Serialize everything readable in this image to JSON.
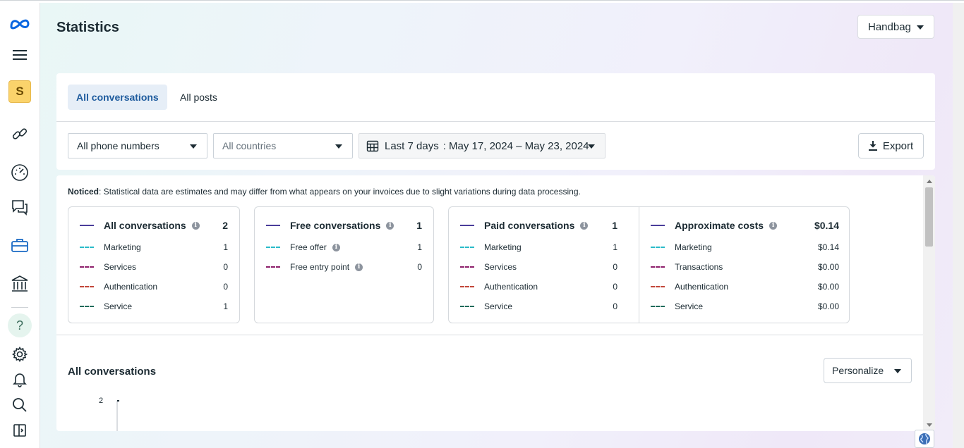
{
  "page": {
    "title": "Statistics"
  },
  "sidebar": {
    "items": [
      {
        "name": "meta-logo-icon"
      },
      {
        "name": "menu-icon"
      },
      {
        "name": "account-avatar",
        "label": "S"
      },
      {
        "name": "link-icon"
      },
      {
        "name": "dashboard-gauge-icon"
      },
      {
        "name": "chat-bubbles-icon"
      },
      {
        "name": "briefcase-icon"
      },
      {
        "name": "bank-icon"
      },
      {
        "name": "help-icon",
        "label": "?"
      },
      {
        "name": "gear-icon"
      },
      {
        "name": "bell-icon"
      },
      {
        "name": "search-icon"
      },
      {
        "name": "sidebar-panel-icon"
      }
    ]
  },
  "header": {
    "account_selector": "Handbag"
  },
  "tabs": [
    {
      "label": "All conversations",
      "active": true
    },
    {
      "label": "All posts",
      "active": false
    }
  ],
  "filters": {
    "phone": "All phone numbers",
    "country": "All countries",
    "date_range_label": "Last 7 days",
    "date_range": ": May 17, 2024 – May 23, 2024",
    "export_label": "Export"
  },
  "notice": {
    "label": "Noticed",
    "text": ": Statistical data are estimates and may differ from what appears on your invoices due to slight variations during data processing."
  },
  "stats": {
    "all_conversations": {
      "title": "All conversations",
      "total": "2",
      "rows": [
        {
          "label": "Marketing",
          "value": "1",
          "color": "#2bbbc9"
        },
        {
          "label": "Services",
          "value": "0",
          "color": "#8e1f6b"
        },
        {
          "label": "Authentication",
          "value": "0",
          "color": "#c2473a"
        },
        {
          "label": "Service",
          "value": "1",
          "color": "#1f6b5a"
        }
      ]
    },
    "free_conversations": {
      "title": "Free conversations",
      "total": "1",
      "rows": [
        {
          "label": "Free offer",
          "value": "1",
          "color": "#2bbbc9"
        },
        {
          "label": "Free entry point",
          "value": "0",
          "color": "#8e1f6b"
        }
      ]
    },
    "paid_conversations": {
      "title": "Paid conversations",
      "total": "1",
      "rows": [
        {
          "label": "Marketing",
          "value": "1",
          "color": "#2bbbc9"
        },
        {
          "label": "Services",
          "value": "0",
          "color": "#8e1f6b"
        },
        {
          "label": "Authentication",
          "value": "0",
          "color": "#c2473a"
        },
        {
          "label": "Service",
          "value": "0",
          "color": "#1f6b5a"
        }
      ]
    },
    "approximate_costs": {
      "title": "Approximate costs",
      "total": "$0.14",
      "rows": [
        {
          "label": "Marketing",
          "value": "$0.14",
          "color": "#2bbbc9"
        },
        {
          "label": "Transactions",
          "value": "$0.00",
          "color": "#8e1f6b"
        },
        {
          "label": "Authentication",
          "value": "$0.00",
          "color": "#c2473a"
        },
        {
          "label": "Service",
          "value": "$0.00",
          "color": "#1f6b5a"
        }
      ]
    }
  },
  "chart_section": {
    "title": "All conversations",
    "personalize_label": "Personalize",
    "y_tick": "2"
  },
  "colors": {
    "accent": "#1f5c9e",
    "series_primary": "#4a3d9a"
  }
}
